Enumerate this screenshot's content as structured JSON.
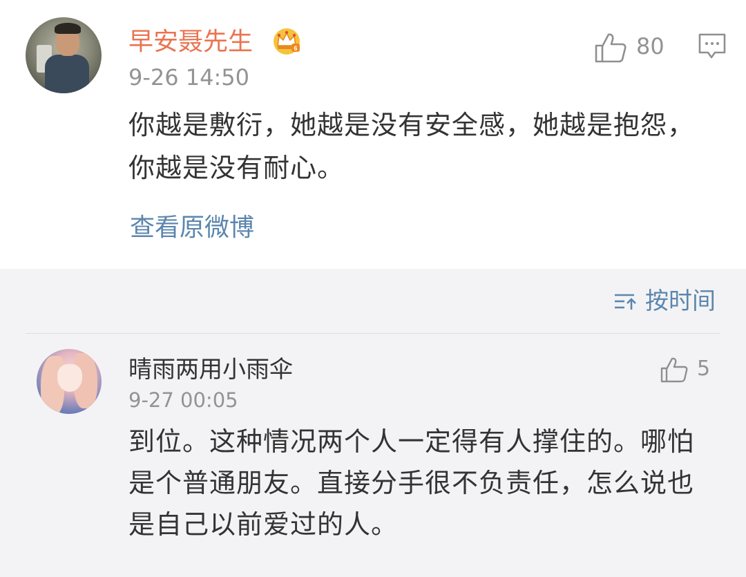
{
  "main_comment": {
    "username": "早安聂先生",
    "timestamp": "9-26 14:50",
    "likes": "80",
    "content": "你越是敷衍，她越是没有安全感，她越是抱怨，你越是没有耐心。",
    "view_original": "查看原微博",
    "icons": {
      "avatar": "user-avatar",
      "vip": "crown-vip-icon",
      "like": "thumbs-up-icon",
      "reply": "comment-bubble-icon"
    }
  },
  "sort": {
    "label": "按时间",
    "icon": "sort-icon"
  },
  "replies": [
    {
      "username": "晴雨两用小雨伞",
      "timestamp": "9-27 00:05",
      "likes": "5",
      "content": "到位。这种情况两个人一定得有人撑住的。哪怕是个普通朋友。直接分手很不负责任，怎么说也是自己以前爱过的人。"
    }
  ],
  "colors": {
    "username_accent": "#eb7350",
    "link_blue": "#5b86ad",
    "text_primary": "#333333",
    "text_secondary": "#939393",
    "background": "#f3f3f5",
    "card": "#ffffff"
  }
}
